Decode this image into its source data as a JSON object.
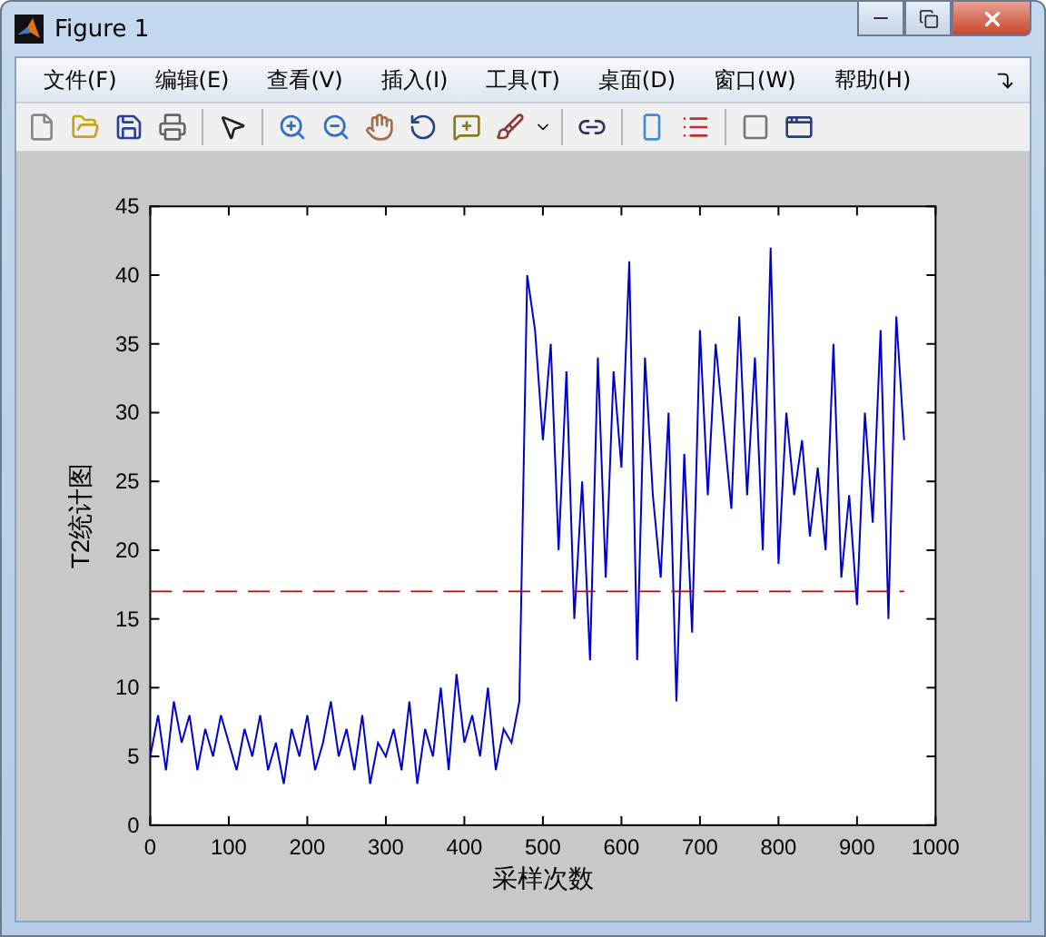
{
  "window": {
    "title": "Figure 1"
  },
  "menu": [
    {
      "label": "文件(F)"
    },
    {
      "label": "编辑(E)"
    },
    {
      "label": "查看(V)"
    },
    {
      "label": "插入(I)"
    },
    {
      "label": "工具(T)"
    },
    {
      "label": "桌面(D)"
    },
    {
      "label": "窗口(W)"
    },
    {
      "label": "帮助(H)"
    }
  ],
  "plot": {
    "chart_data": {
      "type": "line",
      "xlabel": "采样次数",
      "ylabel": "T2统计图",
      "xlim": [
        0,
        1000
      ],
      "ylim": [
        0,
        45
      ],
      "xticks": [
        0,
        100,
        200,
        300,
        400,
        500,
        600,
        700,
        800,
        900,
        1000
      ],
      "yticks": [
        0,
        5,
        10,
        15,
        20,
        25,
        30,
        35,
        40,
        45
      ],
      "x": [
        0,
        10,
        20,
        30,
        40,
        50,
        60,
        70,
        80,
        90,
        100,
        110,
        120,
        130,
        140,
        150,
        160,
        170,
        180,
        190,
        200,
        210,
        220,
        230,
        240,
        250,
        260,
        270,
        280,
        290,
        300,
        310,
        320,
        330,
        340,
        350,
        360,
        370,
        380,
        390,
        400,
        410,
        420,
        430,
        440,
        450,
        460,
        470,
        480,
        490,
        500,
        510,
        520,
        530,
        540,
        550,
        560,
        570,
        580,
        590,
        600,
        610,
        620,
        630,
        640,
        650,
        660,
        670,
        680,
        690,
        700,
        710,
        720,
        730,
        740,
        750,
        760,
        770,
        780,
        790,
        800,
        810,
        820,
        830,
        840,
        850,
        860,
        870,
        880,
        890,
        900,
        910,
        920,
        930,
        940,
        950,
        960
      ],
      "series": [
        {
          "color": "#0000cc",
          "line_style": "solid",
          "values": [
            5,
            8,
            4,
            9,
            6,
            8,
            4,
            7,
            5,
            8,
            6,
            4,
            7,
            5,
            8,
            4,
            6,
            3,
            7,
            5,
            8,
            4,
            6,
            9,
            5,
            7,
            4,
            8,
            3,
            6,
            5,
            7,
            4,
            9,
            3,
            7,
            5,
            10,
            4,
            11,
            6,
            8,
            5,
            10,
            4,
            7,
            6,
            9,
            40,
            36,
            28,
            35,
            20,
            33,
            15,
            25,
            12,
            34,
            18,
            33,
            26,
            41,
            12,
            34,
            24,
            18,
            30,
            9,
            27,
            14,
            36,
            24,
            35,
            29,
            23,
            37,
            24,
            34,
            20,
            42,
            19,
            30,
            24,
            28,
            21,
            26,
            20,
            35,
            18,
            24,
            16,
            30,
            22,
            36,
            15,
            37,
            28
          ]
        },
        {
          "color": "#cc0000",
          "line_style": "dashed",
          "values": [
            17,
            17,
            17,
            17,
            17,
            17,
            17,
            17,
            17,
            17,
            17,
            17,
            17,
            17,
            17,
            17,
            17,
            17,
            17,
            17,
            17,
            17,
            17,
            17,
            17,
            17,
            17,
            17,
            17,
            17,
            17,
            17,
            17,
            17,
            17,
            17,
            17,
            17,
            17,
            17,
            17,
            17,
            17,
            17,
            17,
            17,
            17,
            17,
            17,
            17,
            17,
            17,
            17,
            17,
            17,
            17,
            17,
            17,
            17,
            17,
            17,
            17,
            17,
            17,
            17,
            17,
            17,
            17,
            17,
            17,
            17,
            17,
            17,
            17,
            17,
            17,
            17,
            17,
            17,
            17,
            17,
            17,
            17,
            17,
            17,
            17,
            17,
            17,
            17,
            17,
            17,
            17,
            17,
            17,
            17,
            17,
            17
          ]
        }
      ]
    }
  }
}
